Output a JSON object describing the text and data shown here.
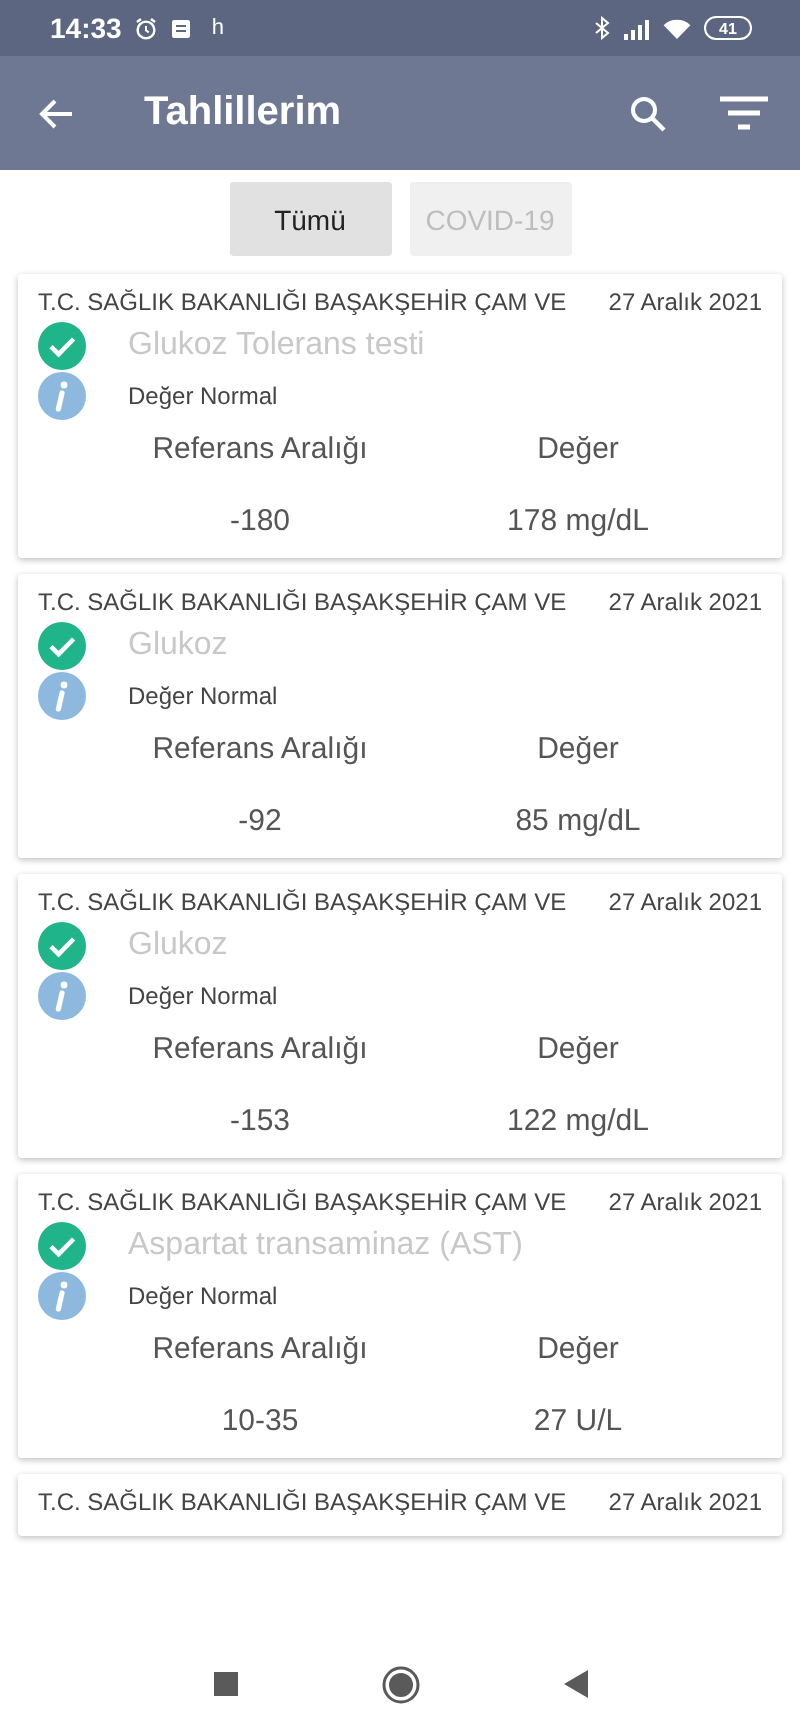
{
  "status_bar": {
    "time": "14:33",
    "carrier": "h",
    "battery": "41"
  },
  "app_bar": {
    "title": "Tahlillerim"
  },
  "tabs": [
    {
      "label": "Tümü",
      "selected": true
    },
    {
      "label": "COVID-19",
      "selected": false
    }
  ],
  "results": [
    {
      "hospital": "T.C. SAĞLIK BAKANLIĞI BAŞAKŞEHİR ÇAM VE",
      "date": "27 Aralık 2021",
      "test": "Glukoz Tolerans testi",
      "status": "Değer Normal",
      "reference_label": "Referans Aralığı",
      "value_label": "Değer",
      "reference": "-180",
      "value": "178 mg/dL"
    },
    {
      "hospital": "T.C. SAĞLIK BAKANLIĞI BAŞAKŞEHİR ÇAM VE",
      "date": "27 Aralık 2021",
      "test": "Glukoz",
      "status": "Değer Normal",
      "reference_label": "Referans Aralığı",
      "value_label": "Değer",
      "reference": "-92",
      "value": "85 mg/dL"
    },
    {
      "hospital": "T.C. SAĞLIK BAKANLIĞI BAŞAKŞEHİR ÇAM VE",
      "date": "27 Aralık 2021",
      "test": "Glukoz",
      "status": "Değer Normal",
      "reference_label": "Referans Aralığı",
      "value_label": "Değer",
      "reference": "-153",
      "value": "122 mg/dL"
    },
    {
      "hospital": "T.C. SAĞLIK BAKANLIĞI BAŞAKŞEHİR ÇAM VE",
      "date": "27 Aralık 2021",
      "test": "Aspartat transaminaz (AST)",
      "status": "Değer Normal",
      "reference_label": "Referans Aralığı",
      "value_label": "Değer",
      "reference": "10-35",
      "value": "27 U/L"
    },
    {
      "hospital": "T.C. SAĞLIK BAKANLIĞI BAŞAKŞEHİR ÇAM VE",
      "date": "27 Aralık 2021"
    }
  ]
}
